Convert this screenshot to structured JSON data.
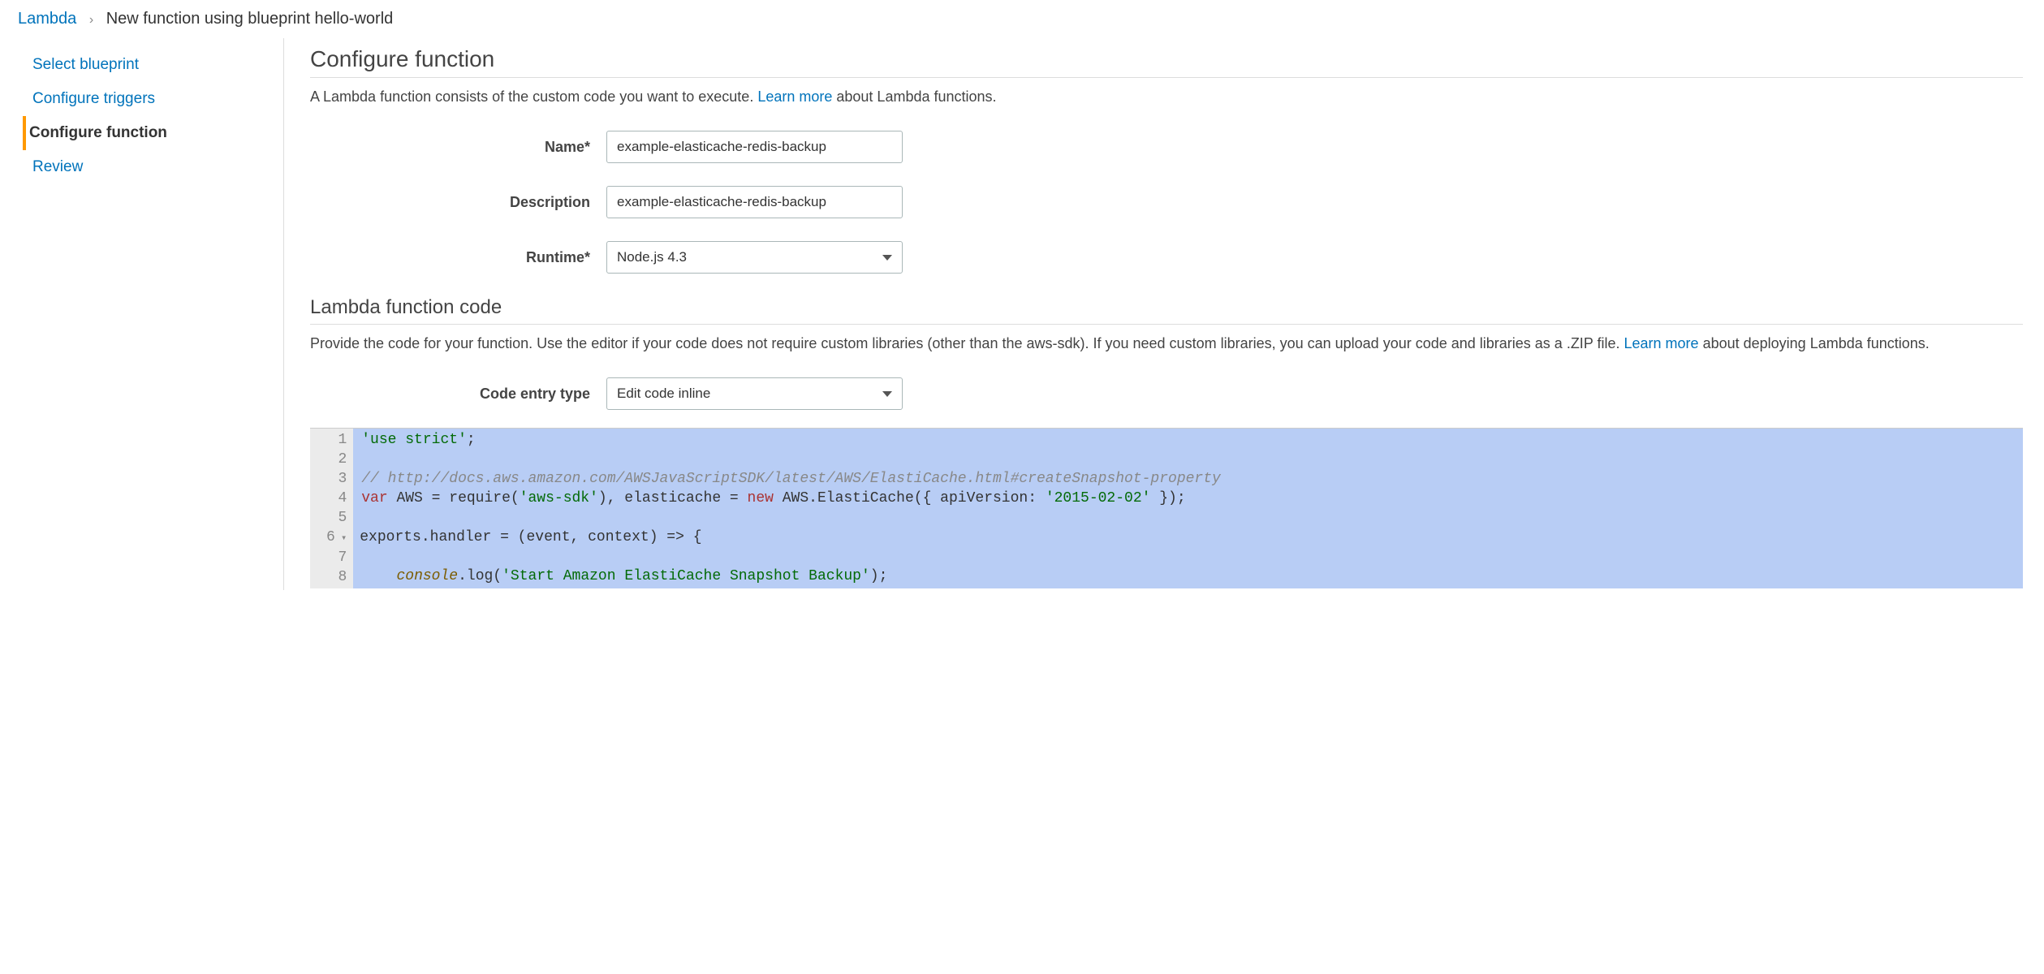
{
  "breadcrumb": {
    "root": "Lambda",
    "current": "New function using blueprint hello-world"
  },
  "sidebar": {
    "items": [
      {
        "label": "Select blueprint",
        "active": false
      },
      {
        "label": "Configure triggers",
        "active": false
      },
      {
        "label": "Configure function",
        "active": true
      },
      {
        "label": "Review",
        "active": false
      }
    ]
  },
  "configure": {
    "title": "Configure function",
    "intro_prefix": "A Lambda function consists of the custom code you want to execute. ",
    "intro_link": "Learn more",
    "intro_suffix": " about Lambda functions.",
    "name_label": "Name*",
    "name_value": "example-elasticache-redis-backup",
    "description_label": "Description",
    "description_value": "example-elasticache-redis-backup",
    "runtime_label": "Runtime*",
    "runtime_value": "Node.js 4.3"
  },
  "code_section": {
    "title": "Lambda function code",
    "intro_prefix": "Provide the code for your function. Use the editor if your code does not require custom libraries (other than the aws-sdk). If you need custom libraries, you can upload your code and libraries as a .ZIP file. ",
    "intro_link": "Learn more",
    "intro_suffix": " about deploying Lambda functions.",
    "entry_label": "Code entry type",
    "entry_value": "Edit code inline"
  },
  "editor": {
    "lines": [
      "'use strict';",
      "",
      "// http://docs.aws.amazon.com/AWSJavaScriptSDK/latest/AWS/ElastiCache.html#createSnapshot-property",
      "var AWS = require('aws-sdk'), elasticache = new AWS.ElastiCache({ apiVersion: '2015-02-02' });",
      "",
      "exports.handler = (event, context) => {",
      "",
      "    console.log('Start Amazon ElastiCache Snapshot Backup');"
    ]
  }
}
